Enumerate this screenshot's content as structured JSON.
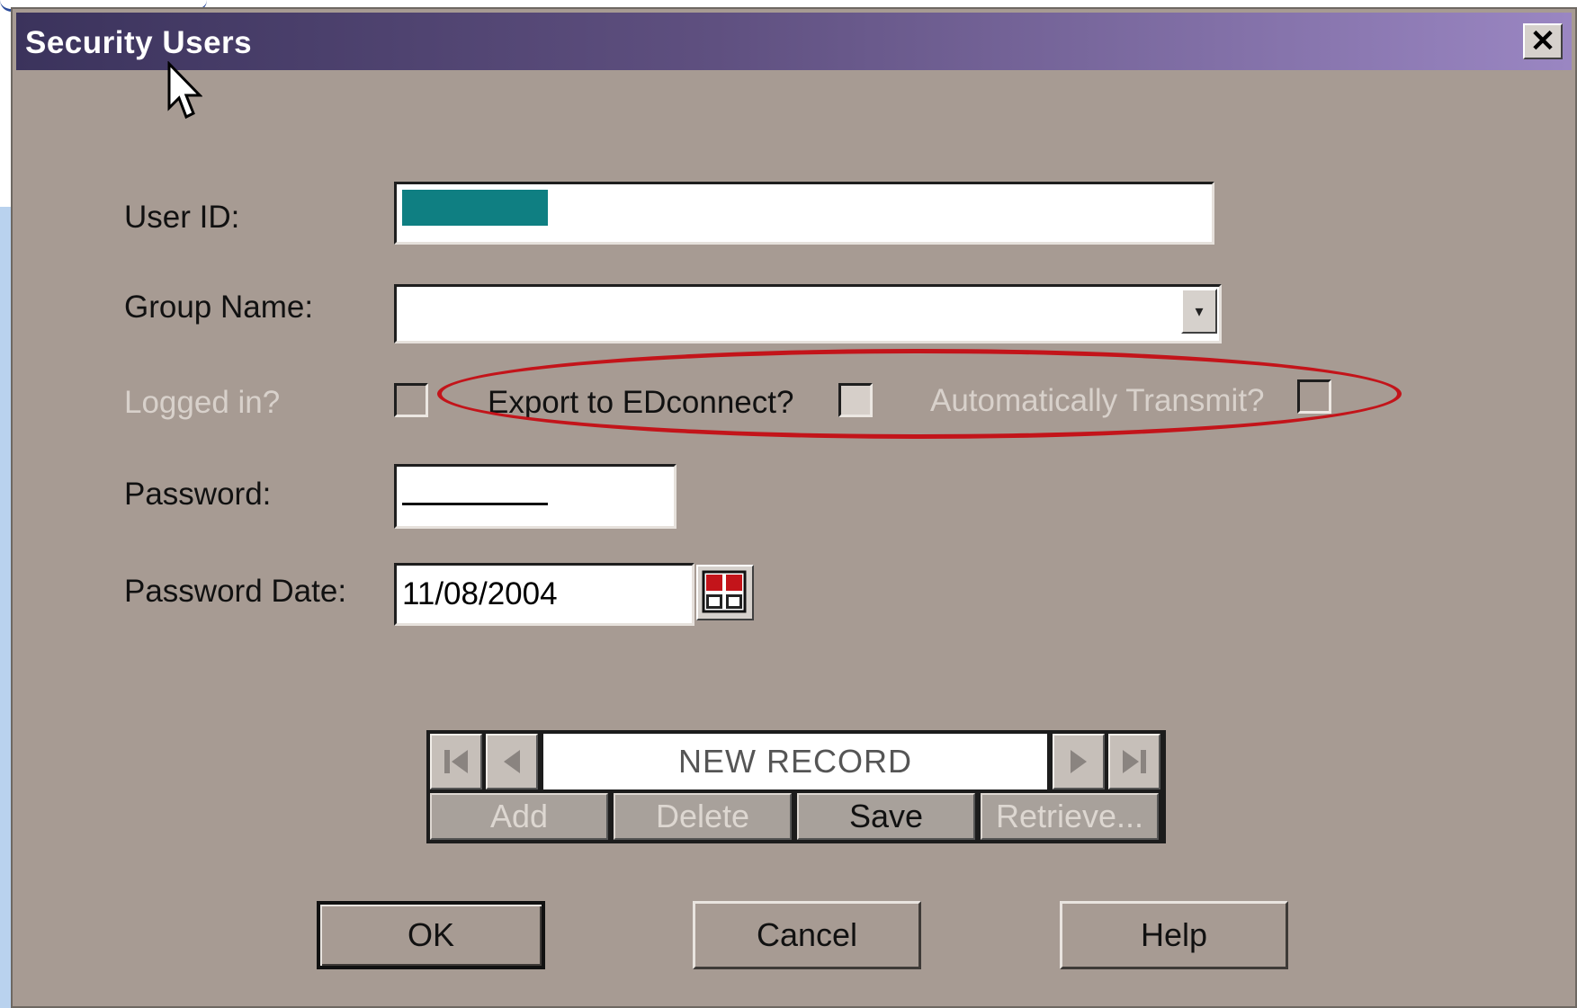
{
  "window": {
    "title": "Security Users"
  },
  "form": {
    "user_id_label": "User ID:",
    "user_id_value": "",
    "group_name_label": "Group Name:",
    "group_name_value": "",
    "logged_in_label": "Logged in?",
    "export_label": "Export to EDconnect?",
    "auto_transmit_label": "Automatically Transmit?",
    "password_label": "Password:",
    "password_date_label": "Password Date:",
    "password_date_value": "11/08/2004"
  },
  "navigator": {
    "status": "NEW RECORD",
    "add_label": "Add",
    "delete_label": "Delete",
    "save_label": "Save",
    "retrieve_label": "Retrieve..."
  },
  "buttons": {
    "ok_label": "OK",
    "cancel_label": "Cancel",
    "help_label": "Help"
  },
  "colors": {
    "dialog_bg": "#a79b93",
    "title_gradient_start": "#3b335c",
    "title_gradient_end": "#9a86c2",
    "selection": "#0f7f82",
    "highlight_ellipse": "#c3141a"
  },
  "icons": {
    "close": "close-icon",
    "cursor": "mouse-pointer-icon",
    "dropdown": "chevron-down-icon",
    "calendar": "calendar-icon",
    "first": "first-record-icon",
    "prev": "previous-record-icon",
    "next": "next-record-icon",
    "last": "last-record-icon"
  }
}
